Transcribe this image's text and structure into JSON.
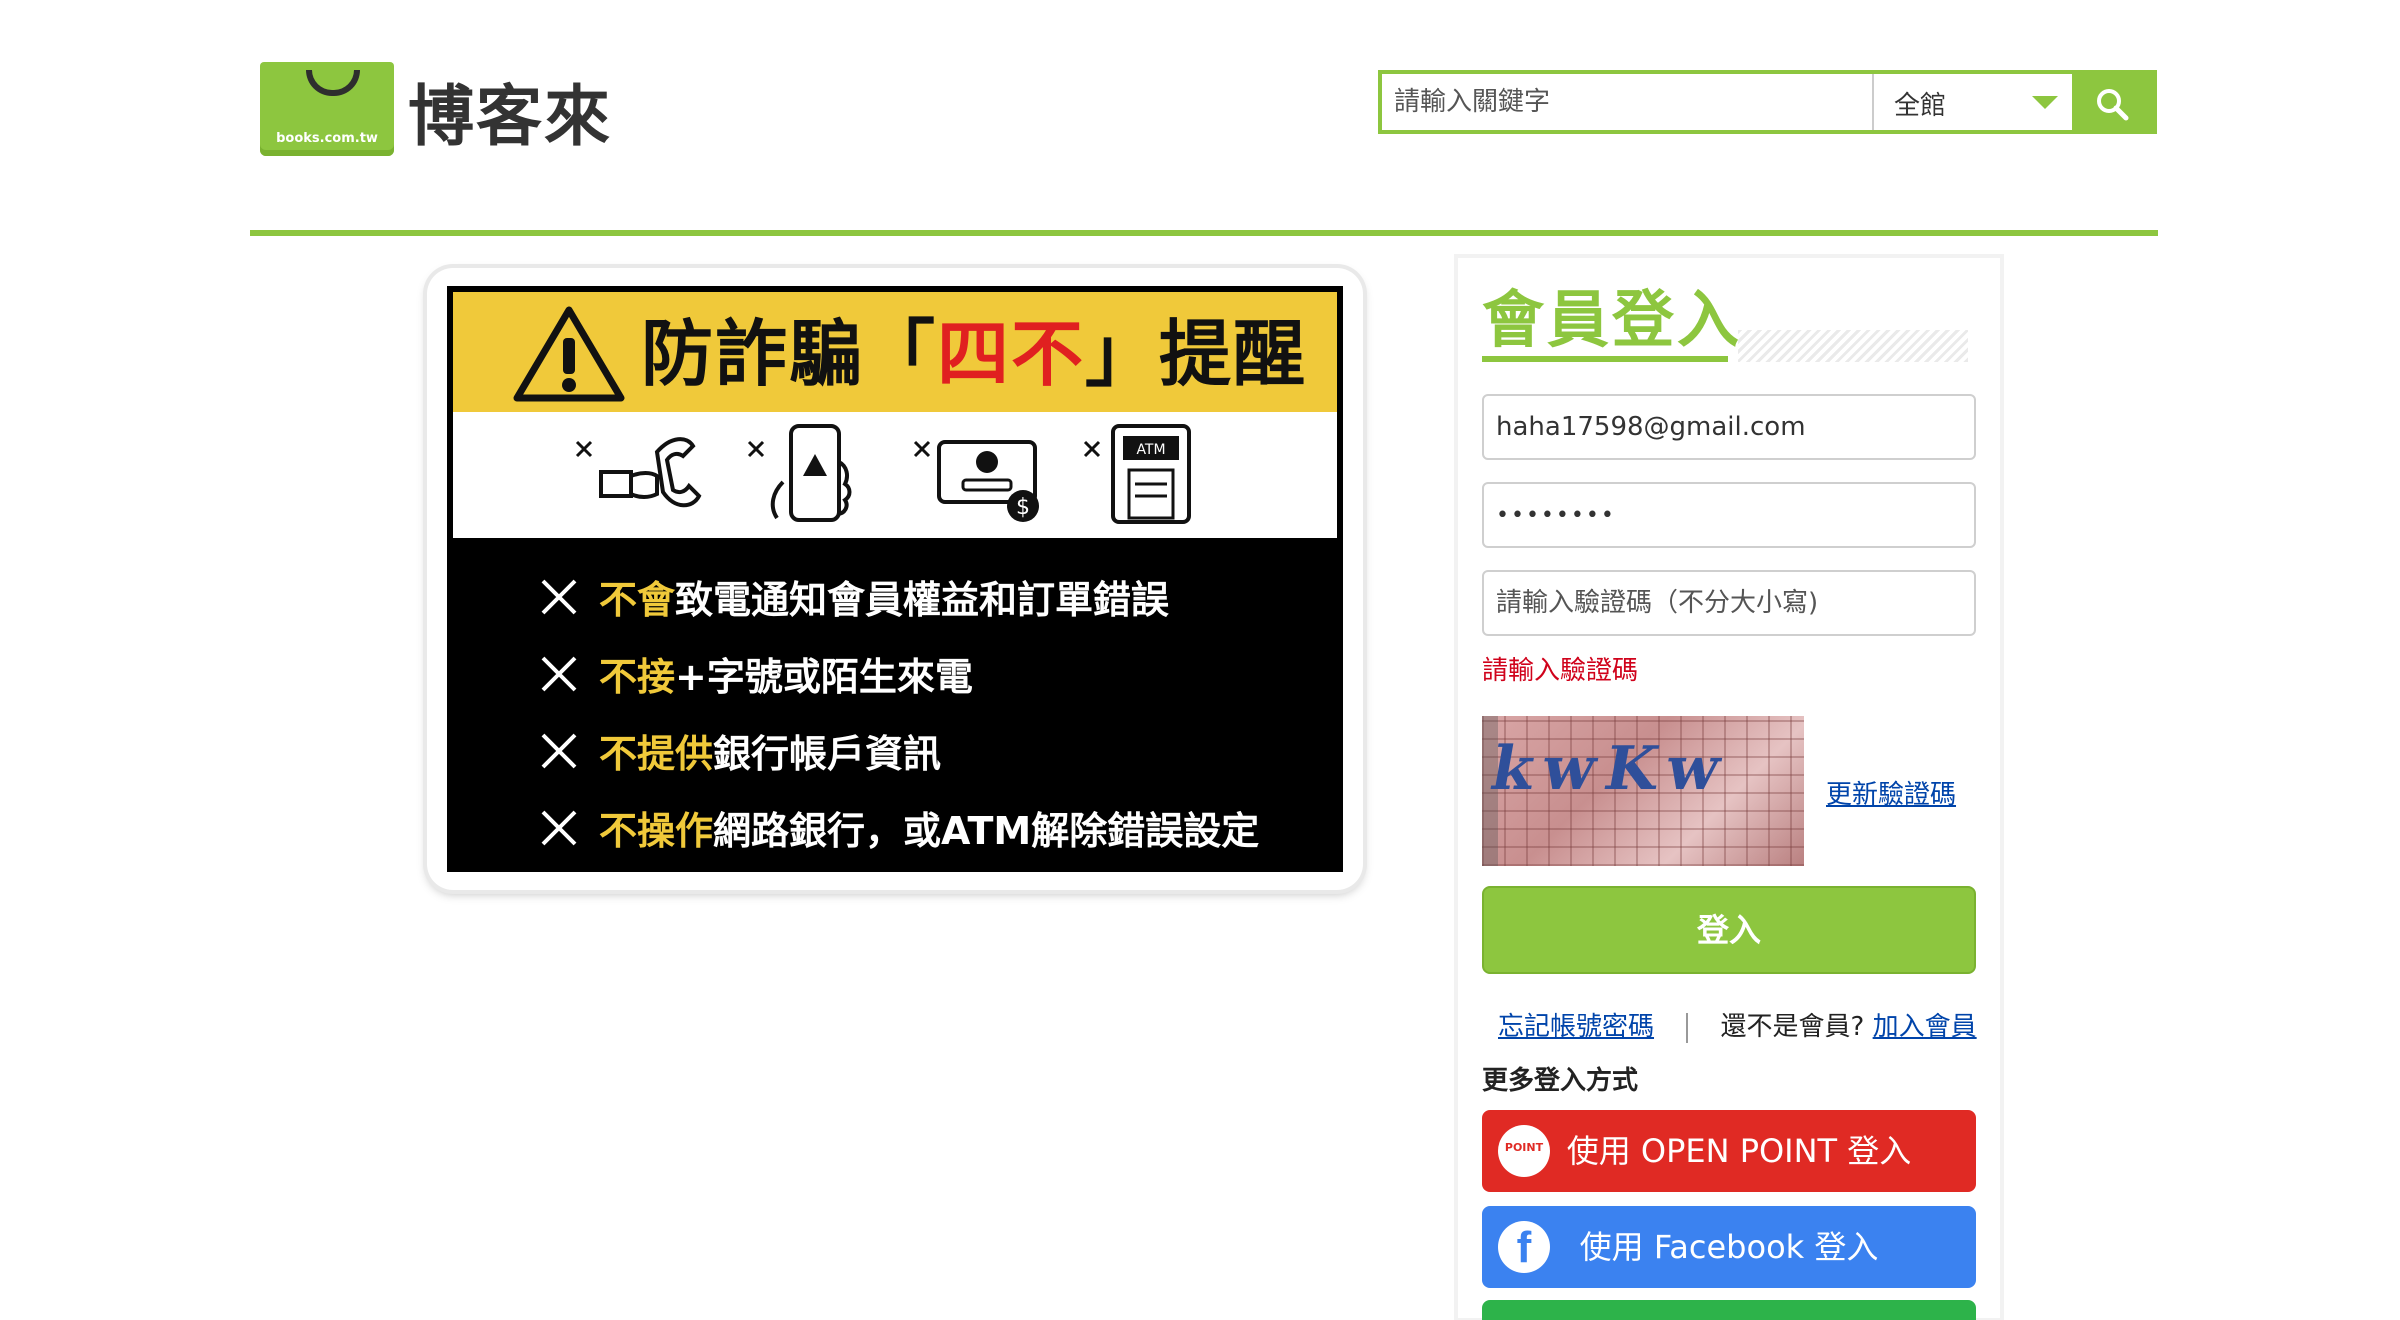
{
  "header": {
    "logo_domain": "books.com.tw",
    "logo_name": "博客來",
    "search": {
      "placeholder": "請輸入關鍵字",
      "category": "全館"
    }
  },
  "banner": {
    "title_prefix": "防詐騙「",
    "title_highlight": "四不",
    "title_suffix": "」提醒",
    "rules": [
      {
        "highlight": "不會",
        "text": "致電通知會員權益和訂單錯誤"
      },
      {
        "highlight": "不接",
        "text": "+字號或陌生來電"
      },
      {
        "highlight": "不提供",
        "text": "銀行帳戶資訊"
      },
      {
        "highlight": "不操作",
        "text": "網路銀行，或ATM解除錯誤設定"
      }
    ]
  },
  "login": {
    "title": "會員登入",
    "email_value": "haha17598@gmail.com",
    "password_value": "••••••••",
    "captcha_placeholder": "請輸入驗證碼（不分大小寫)",
    "captcha_error": "請輸入驗證碼",
    "captcha_text": "kwKw",
    "refresh_link": "更新驗證碼",
    "submit_label": "登入",
    "forgot_link": "忘記帳號密碼",
    "not_member_text": "還不是會員?",
    "join_link": "加入會員",
    "more_login_label": "更多登入方式",
    "openpoint_badge": "POINT",
    "openpoint_label": "使用 OPEN POINT 登入",
    "facebook_label": "使用 Facebook 登入"
  },
  "colors": {
    "brand_green": "#8dc63f",
    "error_red": "#d0021b",
    "openpoint_red": "#e02a24",
    "facebook_blue": "#3b82f0",
    "warning_yellow": "#f0c93a"
  },
  "icons": {
    "search": "search-icon",
    "dropdown": "chevron-down-icon",
    "warning": "warning-triangle-icon",
    "facebook": "facebook-icon",
    "openpoint": "openpoint-icon"
  }
}
